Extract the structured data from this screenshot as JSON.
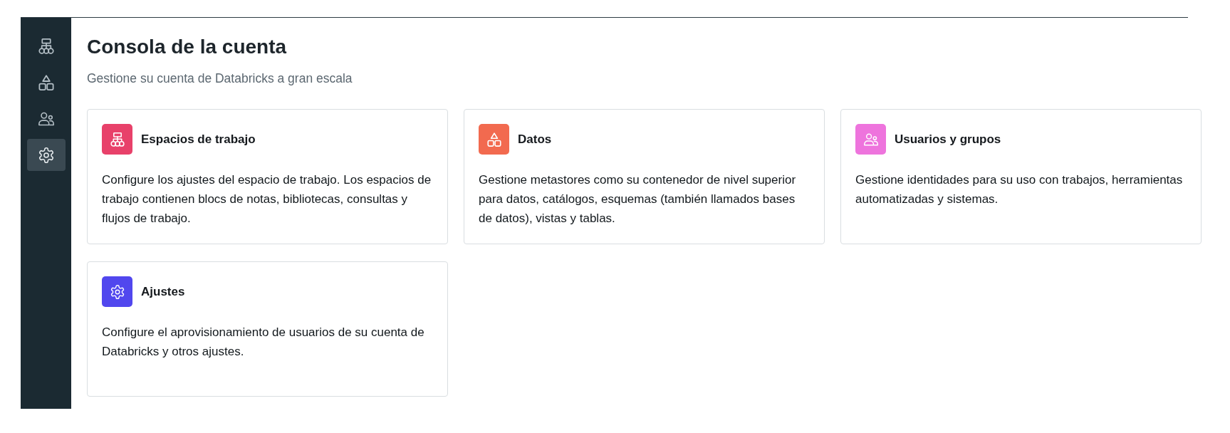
{
  "page": {
    "title": "Consola de la cuenta",
    "subtitle": "Gestione su cuenta de Databricks a gran escala"
  },
  "sidebar": {
    "items": [
      {
        "kind": "workspaces",
        "selected": false
      },
      {
        "kind": "data",
        "selected": false
      },
      {
        "kind": "users",
        "selected": false
      },
      {
        "kind": "settings",
        "selected": true
      }
    ]
  },
  "cards": [
    {
      "kind": "workspaces",
      "title": "Espacios de trabajo",
      "description": "Configure los ajustes del espacio de trabajo. Los espacios de trabajo contienen blocs de notas, bibliotecas, consultas y flujos de trabajo.",
      "color": "#e8416a"
    },
    {
      "kind": "data",
      "title": "Datos",
      "description": "Gestione metastores como su contenedor de nivel superior para datos, catálogos, esquemas (también llamados bases de datos), vistas y tablas.",
      "color": "#f26a4f"
    },
    {
      "kind": "users",
      "title": "Usuarios y grupos",
      "description": "Gestione identidades para su uso con trabajos, herramientas automatizadas y sistemas.",
      "color": "#ee74dd"
    },
    {
      "kind": "settings",
      "title": "Ajustes",
      "description": "Configure el aprovisionamiento de usuarios de su cuenta de Databricks y otros ajustes.",
      "color": "#5147ee"
    }
  ]
}
